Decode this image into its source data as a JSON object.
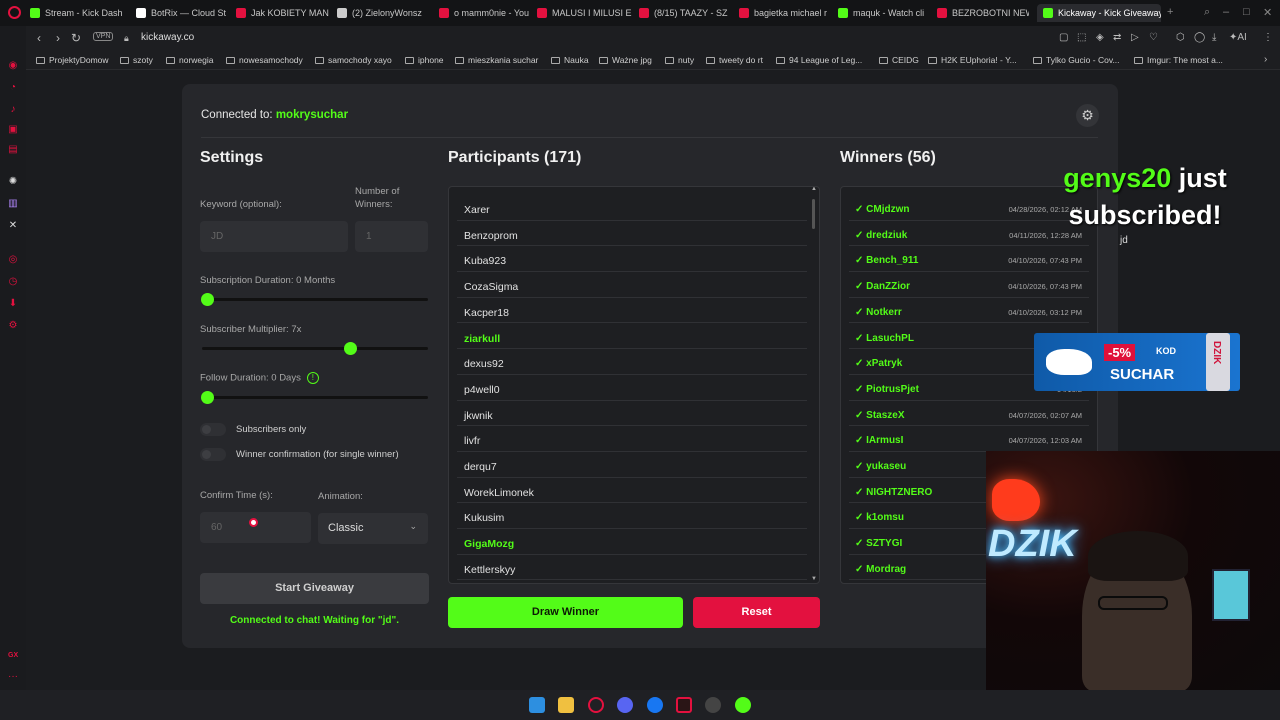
{
  "browser": {
    "tabs": [
      {
        "label": "Stream - Kick Dash",
        "color": "#53fc18"
      },
      {
        "label": "BotRix — Cloud St",
        "color": "#ffffff"
      },
      {
        "label": "Jak KOBIETY MAN",
        "color": "#e3113f"
      },
      {
        "label": "(2) ZielonyWonsz",
        "color": "#cccccc"
      },
      {
        "label": "o mamm0nie - You",
        "color": "#e3113f"
      },
      {
        "label": "MALUSI I MILUSI E",
        "color": "#e3113f"
      },
      {
        "label": "(8/15) TAAZY - SZ",
        "color": "#e3113f"
      },
      {
        "label": "bagietka michael r",
        "color": "#e3113f"
      },
      {
        "label": "maquk - Watch cli",
        "color": "#53fc18"
      },
      {
        "label": "BEZROBOTNI NEW",
        "color": "#e3113f"
      },
      {
        "label": "Kickaway - Kick Giveaway",
        "color": "#53fc18"
      }
    ],
    "vpn": "VPN",
    "url": "kickaway.co",
    "ai": "AI",
    "bookmarks": [
      "ProjektyDomow",
      "szoty",
      "norwegia",
      "nowesamochody",
      "samochody xayo",
      "iphone",
      "mieszkania suchar",
      "Nauka",
      "Ważne jpg",
      "nuty",
      "tweety do rt",
      "94 League of Leg...",
      "CEIDG",
      "H2K EUphoria! - Y...",
      "Tylko Gucio - Cov...",
      "Imgur: The most a..."
    ]
  },
  "app": {
    "connected_label": "Connected to:",
    "channel": "mokrysuchar",
    "settings": {
      "title": "Settings",
      "keyword_label": "Keyword (optional):",
      "keyword_placeholder": "JD",
      "winners_label": "Number of Winners:",
      "winners_value": "1",
      "sub_duration_label": "Subscription Duration: 0 Months",
      "sub_duration_value": 0,
      "multiplier_label": "Subscriber Multiplier: 7x",
      "multiplier_value": 0.67,
      "follow_label": "Follow Duration:  0  Days",
      "follow_value": 0,
      "subs_only_label": "Subscribers only",
      "confirm_label": "Winner confirmation (for single winner)",
      "confirm_time_label": "Confirm Time (s):",
      "confirm_time_value": "60",
      "animation_label": "Animation:",
      "animation_value": "Classic",
      "start_label": "Start Giveaway",
      "status": "Connected to chat! Waiting for \"jd\"."
    },
    "participants": {
      "title": "Participants (171)",
      "items": [
        {
          "name": "Xarer",
          "highlight": false
        },
        {
          "name": "Benzoprom",
          "highlight": false
        },
        {
          "name": "Kuba923",
          "highlight": false
        },
        {
          "name": "CozaSigma",
          "highlight": false
        },
        {
          "name": "Kacper18",
          "highlight": false
        },
        {
          "name": "ziarkull",
          "highlight": true
        },
        {
          "name": "dexus92",
          "highlight": false
        },
        {
          "name": "p4well0",
          "highlight": false
        },
        {
          "name": "jkwnik",
          "highlight": false
        },
        {
          "name": "livfr",
          "highlight": false
        },
        {
          "name": "derqu7",
          "highlight": false
        },
        {
          "name": "WorekLimonek",
          "highlight": false
        },
        {
          "name": "Kukusim",
          "highlight": false
        },
        {
          "name": "GigaMozg",
          "highlight": true
        },
        {
          "name": "Kettlerskyy",
          "highlight": false
        }
      ]
    },
    "winners": {
      "title": "Winners (56)",
      "items": [
        {
          "name": "✓ CMjdzwn",
          "date": "04/28/2026, 02:12 AM"
        },
        {
          "name": "✓ dredziuk",
          "date": "04/11/2026, 12:28 AM"
        },
        {
          "name": "✓ Bench_911",
          "date": "04/10/2026, 07:43 PM"
        },
        {
          "name": "✓ DanZZior",
          "date": "04/10/2026, 07:43 PM"
        },
        {
          "name": "✓ Notkerr",
          "date": "04/10/2026, 03:12 PM"
        },
        {
          "name": "✓ LasuchPL",
          "date": "04/10/2026"
        },
        {
          "name": "✓ xPatryk",
          "date": "04/10/2"
        },
        {
          "name": "✓ PiotrusPjet",
          "date": "04/10/2"
        },
        {
          "name": "✓ StaszeX",
          "date": "04/07/2026, 02:07 AM"
        },
        {
          "name": "✓ IArmusI",
          "date": "04/07/2026, 12:03 AM"
        },
        {
          "name": "✓ yukaseu",
          "date": ""
        },
        {
          "name": "✓ NIGHTZNERO",
          "date": ""
        },
        {
          "name": "✓ k1omsu",
          "date": ""
        },
        {
          "name": "✓ SZTYGI",
          "date": ""
        },
        {
          "name": "✓ Mordrag",
          "date": ""
        }
      ]
    },
    "draw_label": "Draw Winner",
    "reset_label": "Reset"
  },
  "overlay": {
    "sub_user": "genys20",
    "sub_text": "just subscribed!",
    "sub_small": "jd",
    "ad_discount": "-5%",
    "ad_kod": "KOD",
    "ad_code": "SUCHAR",
    "ad_brand": "DZIK",
    "neon": "DZIK"
  },
  "sidebar_bottom": "GX",
  "colors": {
    "accent": "#53fc18",
    "danger": "#e3113f",
    "bg": "#1b1c1f",
    "card": "#26272b"
  }
}
